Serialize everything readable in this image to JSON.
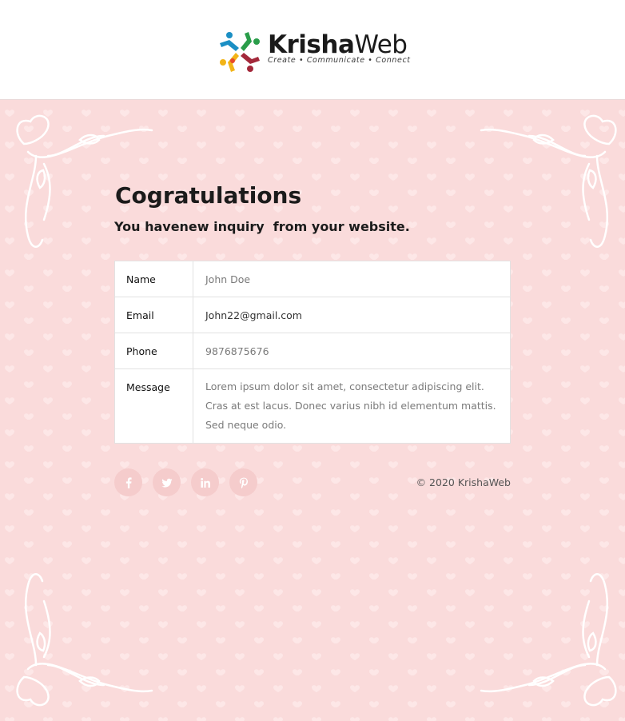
{
  "brand": {
    "name_bold": "Krisha",
    "name_light": "Web",
    "tagline": "Create • Communicate • Connect"
  },
  "email": {
    "title": "Cogratulations",
    "subtitle": "You havenew inquiry  from your website.",
    "fields": [
      {
        "label": "Name",
        "value": "John Doe"
      },
      {
        "label": "Email",
        "value": "John22@gmail.com"
      },
      {
        "label": "Phone",
        "value": "9876875676"
      },
      {
        "label": "Message",
        "value": "Lorem ipsum dolor sit amet, consectetur adipiscing elit. Cras at est lacus. Donec varius nibh id elementum mattis. Sed neque odio."
      }
    ]
  },
  "social": [
    {
      "icon": "facebook-icon"
    },
    {
      "icon": "twitter-icon"
    },
    {
      "icon": "linkedin-icon"
    },
    {
      "icon": "pinterest-icon"
    }
  ],
  "footer": {
    "copyright": "© 2020 KrishaWeb"
  },
  "colors": {
    "background": "#fadbdb",
    "social_circle": "#f5cccc",
    "social_icon": "#ffffff"
  }
}
